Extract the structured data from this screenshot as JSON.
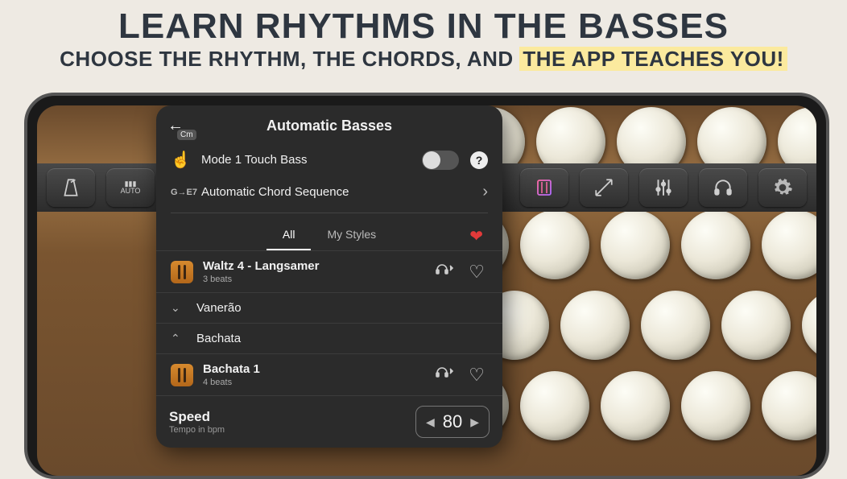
{
  "promo": {
    "title": "LEARN RHYTHMS IN THE BASSES",
    "subtitle_pre": "CHOOSE THE RHYTHM, THE CHORDS, AND ",
    "subtitle_highlight": "THE APP TEACHES YOU!"
  },
  "panel": {
    "back_chip": "Cm",
    "title": "Automatic Basses",
    "option_touch": "Mode 1 Touch Bass",
    "option_sequence": "Automatic Chord Sequence",
    "tabs": {
      "all": "All",
      "mine": "My Styles"
    },
    "group_vanerao": "Vanerão",
    "group_bachata": "Bachata",
    "style1": {
      "name": "Waltz 4 - Langsamer",
      "beats": "3 beats"
    },
    "style2": {
      "name": "Bachata 1",
      "beats": "4 beats"
    },
    "speed": {
      "label": "Speed",
      "sublabel": "Tempo in bpm",
      "value": "80"
    }
  },
  "icons": {
    "back": "←",
    "touch": "☝",
    "sequence": "G→E7",
    "help": "?",
    "chevron": "›",
    "heart": "❤",
    "down": "⌄",
    "up": "⌃",
    "preview": "◉⁾",
    "fav_outline": "♡",
    "tri_left": "◀",
    "tri_right": "▶"
  }
}
